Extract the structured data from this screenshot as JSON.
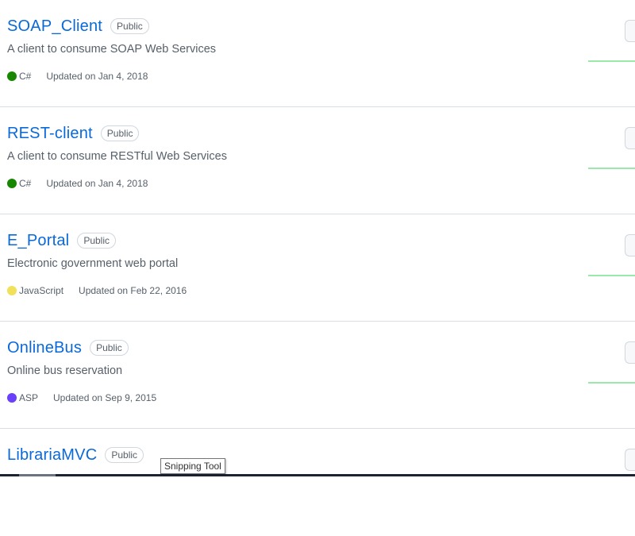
{
  "repos": [
    {
      "name": "SOAP_Client",
      "visibility": "Public",
      "description": "A client to consume SOAP Web Services",
      "language": "C#",
      "language_color": "#178600",
      "updated": "Updated on Jan 4, 2018"
    },
    {
      "name": "REST-client",
      "visibility": "Public",
      "description": "A client to consume RESTful Web Services",
      "language": "C#",
      "language_color": "#178600",
      "updated": "Updated on Jan 4, 2018"
    },
    {
      "name": "E_Portal",
      "visibility": "Public",
      "description": "Electronic government web portal",
      "language": "JavaScript",
      "language_color": "#f1e05a",
      "updated": "Updated on Feb 22, 2016"
    },
    {
      "name": "OnlineBus",
      "visibility": "Public",
      "description": "Online bus reservation",
      "language": "ASP",
      "language_color": "#6a40fd",
      "updated": "Updated on Sep 9, 2015"
    },
    {
      "name": "LibrariaMVC",
      "visibility": "Public"
    }
  ],
  "tooltip": {
    "text": "Snipping Tool"
  }
}
